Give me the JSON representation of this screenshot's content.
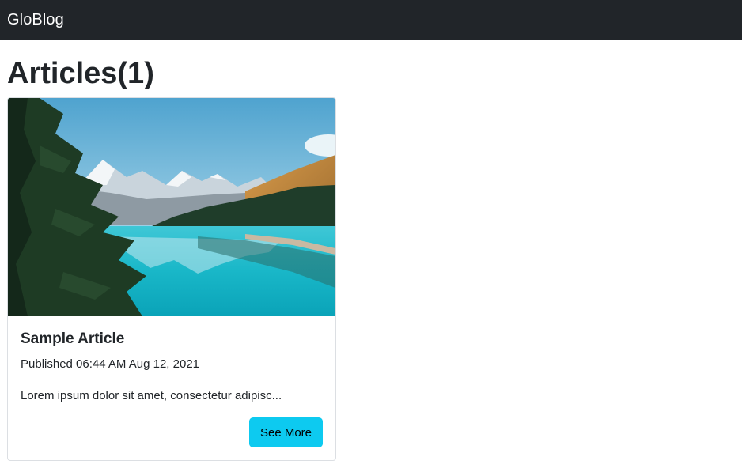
{
  "navbar": {
    "brand": "GloBlog"
  },
  "page": {
    "title": "Articles(1)"
  },
  "articles": [
    {
      "title": "Sample Article",
      "published": "Published 06:44 AM Aug 12, 2021",
      "excerpt": "Lorem ipsum dolor sit amet, consectetur adipisc...",
      "button_label": "See More",
      "image": "mountain-lake-photo"
    }
  ],
  "colors": {
    "navbar_bg": "#212529",
    "button_bg": "#0dcaf0",
    "text": "#212529"
  }
}
